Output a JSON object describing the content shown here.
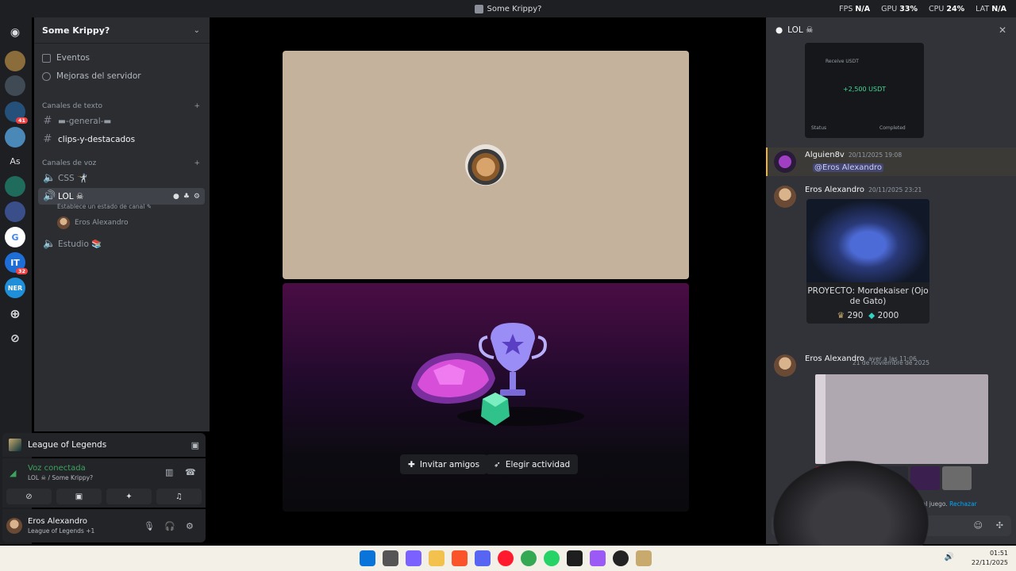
{
  "window": {
    "title": "Some Krippy?"
  },
  "perf": {
    "fps_label": "FPS",
    "fps": "N/A",
    "gpu_label": "GPU",
    "gpu": "33%",
    "cpu_label": "CPU",
    "cpu": "24%",
    "lat_label": "LAT",
    "lat": "N/A"
  },
  "rail": {
    "discord_icon": "discord-icon",
    "as_label": "As",
    "badge_41": "41",
    "badge_32": "32"
  },
  "server": {
    "name": "Some Krippy?"
  },
  "nav": {
    "events": "Eventos",
    "boost": "Mejoras del servidor"
  },
  "text_category": "Canales de texto",
  "text_channels": [
    "▬-general-▬",
    "clips-y-destacados"
  ],
  "voice_category": "Canales de voz",
  "voice_channels": {
    "css": "CSS 🤺",
    "lol": "LOL ☠",
    "lol_status": "Establece un estado de canal ✎",
    "lol_member": "Eros Alexandro",
    "estudio": "Estudio 📚"
  },
  "activity": {
    "game": "League of Legends"
  },
  "voice_panel": {
    "status": "Voz conectada",
    "channel": "LOL ☠ / Some Krippy?"
  },
  "user": {
    "name": "Eros Alexandro",
    "status": "League of Legends +1"
  },
  "stage": {
    "invite": "Invitar amigos",
    "choose_activity": "Elegir actividad"
  },
  "chat": {
    "title": "LOL ☠",
    "messages": [
      {
        "author": "Alguien8v",
        "time": "20/11/2025 19:08",
        "mention": "@Eros Alexandro"
      },
      {
        "author": "Eros Alexandro",
        "time": "20/11/2025 23:21"
      },
      {
        "author": "Eros Alexandro",
        "time": "ayer a las 11:06"
      }
    ],
    "card_title": "PROYECTO: Mordekaiser (Ojo de Gato)",
    "price_rp": "290",
    "price_be": "2000",
    "date_divider": "21 de noviembre de 2025",
    "notice_prefix": "Le",
    "notice_suffix": "s al juego.",
    "reject": "Rechazar",
    "receipt": {
      "received": "Receive USDT",
      "amount": "+2,500 USDT",
      "status_label": "Status",
      "status": "Completed"
    }
  },
  "taskbar": {
    "time": "01:51",
    "date": "22/11/2025"
  },
  "colors": {
    "accent": "#5865f2",
    "online": "#3ba55d",
    "danger": "#f23f42"
  }
}
